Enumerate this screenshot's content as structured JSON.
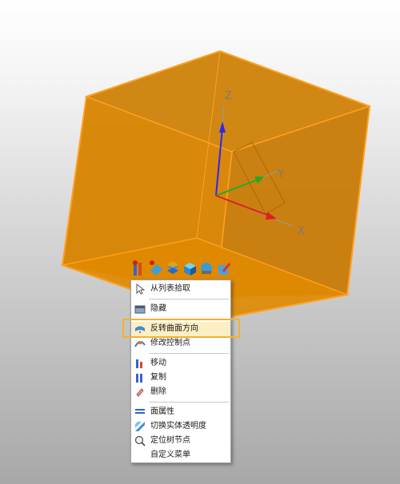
{
  "viewport": {
    "axes": {
      "x_label": "X",
      "y_label": "Y",
      "z_label": "Z"
    }
  },
  "mini_toolbar": {
    "buttons": [
      {
        "icon": "move-filter-icon"
      },
      {
        "icon": "face-filter-icon"
      },
      {
        "icon": "solid-layers-icon"
      },
      {
        "icon": "shaded-box-icon"
      },
      {
        "icon": "display-mode-icon"
      },
      {
        "icon": "pencil-box-icon"
      }
    ]
  },
  "context_menu": {
    "items": [
      {
        "label": "从列表拾取",
        "icon": "cursor-icon"
      },
      {
        "separator": true
      },
      {
        "label": "隐藏",
        "icon": "hide-icon"
      },
      {
        "separator": true
      },
      {
        "label": "反转曲面方向",
        "icon": "reverse-surface-icon",
        "highlighted": true
      },
      {
        "label": "修改控制点",
        "icon": "control-points-icon"
      },
      {
        "separator": true
      },
      {
        "label": "移动",
        "icon": "move-icon"
      },
      {
        "label": "复制",
        "icon": "copy-icon"
      },
      {
        "label": "删除",
        "icon": "delete-icon"
      },
      {
        "separator": true
      },
      {
        "label": "面属性",
        "icon": "face-properties-icon"
      },
      {
        "label": "切换实体透明度",
        "icon": "toggle-transparency-icon"
      },
      {
        "label": "定位树节点",
        "icon": "locate-tree-node-icon"
      },
      {
        "label": "自定义菜单",
        "icon": ""
      }
    ]
  },
  "colors": {
    "solid_face": "#d98200",
    "solid_edge": "#ffa020",
    "highlight_bg": "#fdefc4",
    "highlight_frame": "#f2b133",
    "axis_x": "#e02020",
    "axis_y": "#22aa22",
    "axis_z": "#2a2aee"
  }
}
